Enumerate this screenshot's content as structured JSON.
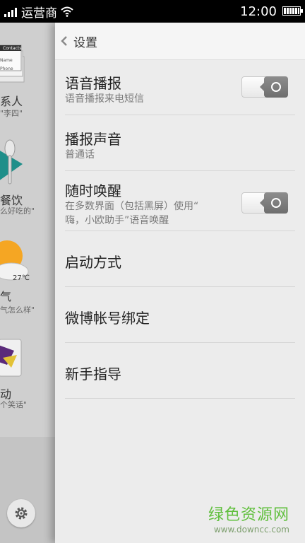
{
  "status_bar": {
    "carrier": "运营商",
    "time": "12:00"
  },
  "left_panel": {
    "items": [
      {
        "title": "系人",
        "sub": "\"李四\""
      },
      {
        "title": "餐饮",
        "sub": "么好吃的\""
      },
      {
        "title": "气",
        "sub": "气怎么样\""
      },
      {
        "title": "动",
        "sub": "个笑话\""
      }
    ],
    "contacts_card_label": "Contacts",
    "contacts_card_lines": [
      "Name",
      "Phone"
    ],
    "weather_temp": "27℃"
  },
  "header": {
    "title": "设置"
  },
  "settings": [
    {
      "title": "语音播报",
      "sub": "语音播报来电短信",
      "toggle": true
    },
    {
      "title": "播报声音",
      "sub": "普通话",
      "toggle": false
    },
    {
      "title": "随时唤醒",
      "sub_lines": [
        "在多数界面（包括黑屏）使用“",
        "嗨，小欧助手”语音唤醒"
      ],
      "toggle": true
    },
    {
      "title": "启动方式"
    },
    {
      "title": "微博帐号绑定"
    },
    {
      "title": "新手指导"
    }
  ],
  "watermark": {
    "main": "绿色资源网",
    "url": "www.downcc.com"
  },
  "colors": {
    "watermark_green": "#5fbf3c",
    "toggle_knob": "#7a7a7a"
  }
}
